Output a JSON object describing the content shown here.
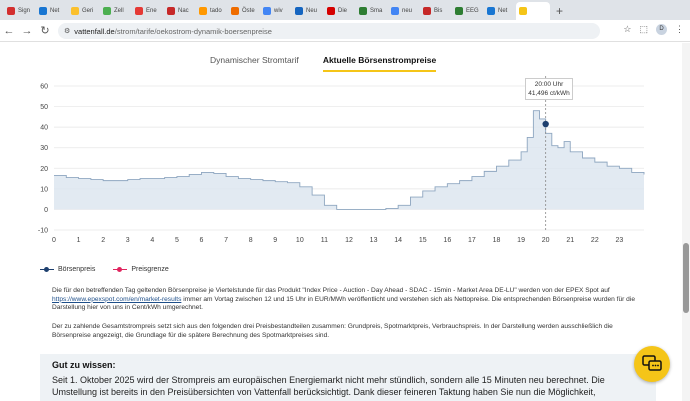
{
  "browser": {
    "tabs": [
      {
        "label": "Sign",
        "color": "#d32f2f"
      },
      {
        "label": "Net",
        "color": "#1976d2"
      },
      {
        "label": "Geri",
        "color": "#fbc02d"
      },
      {
        "label": "Zell",
        "color": "#4caf50"
      },
      {
        "label": "Ene",
        "color": "#e53935"
      },
      {
        "label": "Nac",
        "color": "#c62828"
      },
      {
        "label": "tado",
        "color": "#ff9800"
      },
      {
        "label": "Öste",
        "color": "#ef6c00"
      },
      {
        "label": "wiv",
        "color": "#4285f4"
      },
      {
        "label": "Neu",
        "color": "#1565c0"
      },
      {
        "label": "Die",
        "color": "#d50000"
      },
      {
        "label": "Sma",
        "color": "#2e7d32"
      },
      {
        "label": "neu",
        "color": "#4285f4"
      },
      {
        "label": "Bis",
        "color": "#c62828"
      },
      {
        "label": "EEG",
        "color": "#2e7d32"
      },
      {
        "label": "Net",
        "color": "#1976d2"
      },
      {
        "label": "",
        "color": "#f5c518",
        "active": true
      }
    ],
    "new_tab": "+",
    "url_host": "vattenfall.de",
    "url_path": "/strom/tarife/oekostrom-dynamik-boersenpreise",
    "avatar": "D"
  },
  "page": {
    "tab1": "Dynamischer Stromtarif",
    "tab2": "Aktuelle Börsenstrompreise",
    "tooltip_time": "20:00 Uhr",
    "tooltip_value": "41,496 ct/kWh",
    "legend_price": "Börsenpreis",
    "legend_limit": "Preisgrenze",
    "para1_a": "Die für den betreffenden Tag geltenden Börsenpreise je Viertelstunde für das Produkt \"Index Price - Auction - Day Ahead - SDAC - 15min - Market Area DE-LU\" werden von der EPEX Spot auf ",
    "para1_link": "https://www.epexspot.com/en/market-results",
    "para1_b": " immer am Vortag zwischen 12 und 15 Uhr in EUR/MWh veröffentlicht und verstehen sich als Nettopreise. Die entsprechenden Börsenpreise wurden für die Darstellung hier von uns in Cent/kWh umgerechnet.",
    "para2": "Der zu zahlende Gesamtstrompreis setzt sich aus den folgenden drei Preisbestandteilen zusammen: Grundpreis, Spotmarktpreis, Verbrauchspreis. In der Darstellung werden ausschließlich die Börsenpreise angezeigt, die Grundlage für die spätere Berechnung des Spotmarktpreises sind.",
    "info_title": "Gut zu wissen:",
    "info_text": "Seit 1. Oktober 2025 wird der Strompreis am europäischen Energiemarkt nicht mehr stündlich, sondern alle 15 Minuten neu berechnet. Die Umstellung ist bereits in den Preisübersichten von Vattenfall berücksichtigt. Dank dieser feineren Taktung haben Sie nun die Möglichkeit,"
  },
  "colors": {
    "accent": "#f5c518",
    "price_line": "#1d3f6e",
    "limit_line": "#e0245e",
    "fill": "#dbe5ef"
  },
  "chart_data": {
    "type": "area",
    "x_ticks": [
      0,
      1,
      2,
      3,
      4,
      5,
      6,
      7,
      8,
      9,
      10,
      11,
      12,
      13,
      14,
      15,
      16,
      17,
      18,
      19,
      20,
      21,
      22,
      23
    ],
    "yticks": [
      -10,
      0,
      10,
      20,
      30,
      40,
      50,
      60
    ],
    "ylim": [
      -10,
      60
    ],
    "xlim": [
      0,
      24
    ],
    "highlight": {
      "x": 20,
      "y": 41.5
    },
    "series": [
      {
        "name": "Börsenpreis",
        "x": [
          0,
          0.5,
          1,
          1.5,
          2,
          2.5,
          3,
          3.5,
          4,
          4.5,
          5,
          5.5,
          6,
          6.5,
          7,
          7.5,
          8,
          8.5,
          9,
          9.5,
          10,
          10.5,
          11,
          11.5,
          12,
          12.5,
          13,
          13.5,
          14,
          14.5,
          15,
          15.5,
          16,
          16.5,
          17,
          17.5,
          18,
          18.5,
          19,
          19.25,
          19.5,
          19.75,
          20,
          20.25,
          20.5,
          20.75,
          21,
          21.5,
          22,
          22.5,
          23,
          23.5,
          24
        ],
        "values": [
          16.5,
          15.5,
          15,
          14.5,
          14,
          14,
          14.5,
          15,
          15,
          15.5,
          16,
          17,
          18,
          17.5,
          16,
          15,
          14.5,
          14,
          13.5,
          13,
          11,
          7,
          2,
          0,
          0,
          0,
          0,
          0.5,
          2,
          6,
          9,
          11,
          12.5,
          14,
          16,
          18.5,
          21,
          24,
          28,
          35,
          48,
          44,
          37,
          31,
          30,
          33,
          28,
          25,
          23,
          21,
          20,
          18,
          17
        ]
      }
    ]
  }
}
